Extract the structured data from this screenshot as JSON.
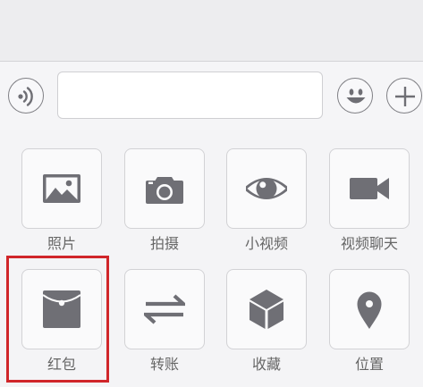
{
  "colors": {
    "icon": "#6f6f75",
    "highlight": "#d0262a",
    "panel_bg": "#f4f4f6"
  },
  "input_bar": {
    "voice_icon": "voice-waves-icon",
    "input_value": "",
    "emoji_icon": "smiley-icon",
    "plus_icon": "plus-icon"
  },
  "panel": {
    "row1": [
      {
        "label": "照片",
        "icon": "image-icon"
      },
      {
        "label": "拍摄",
        "icon": "camera-icon"
      },
      {
        "label": "小视频",
        "icon": "eye-icon"
      },
      {
        "label": "视频聊天",
        "icon": "video-camera-icon"
      }
    ],
    "row2": [
      {
        "label": "红包",
        "icon": "red-packet-icon"
      },
      {
        "label": "转账",
        "icon": "transfer-arrows-icon"
      },
      {
        "label": "收藏",
        "icon": "cube-icon"
      },
      {
        "label": "位置",
        "icon": "location-pin-icon"
      }
    ]
  },
  "annotation": {
    "highlighted_item": "红包"
  }
}
